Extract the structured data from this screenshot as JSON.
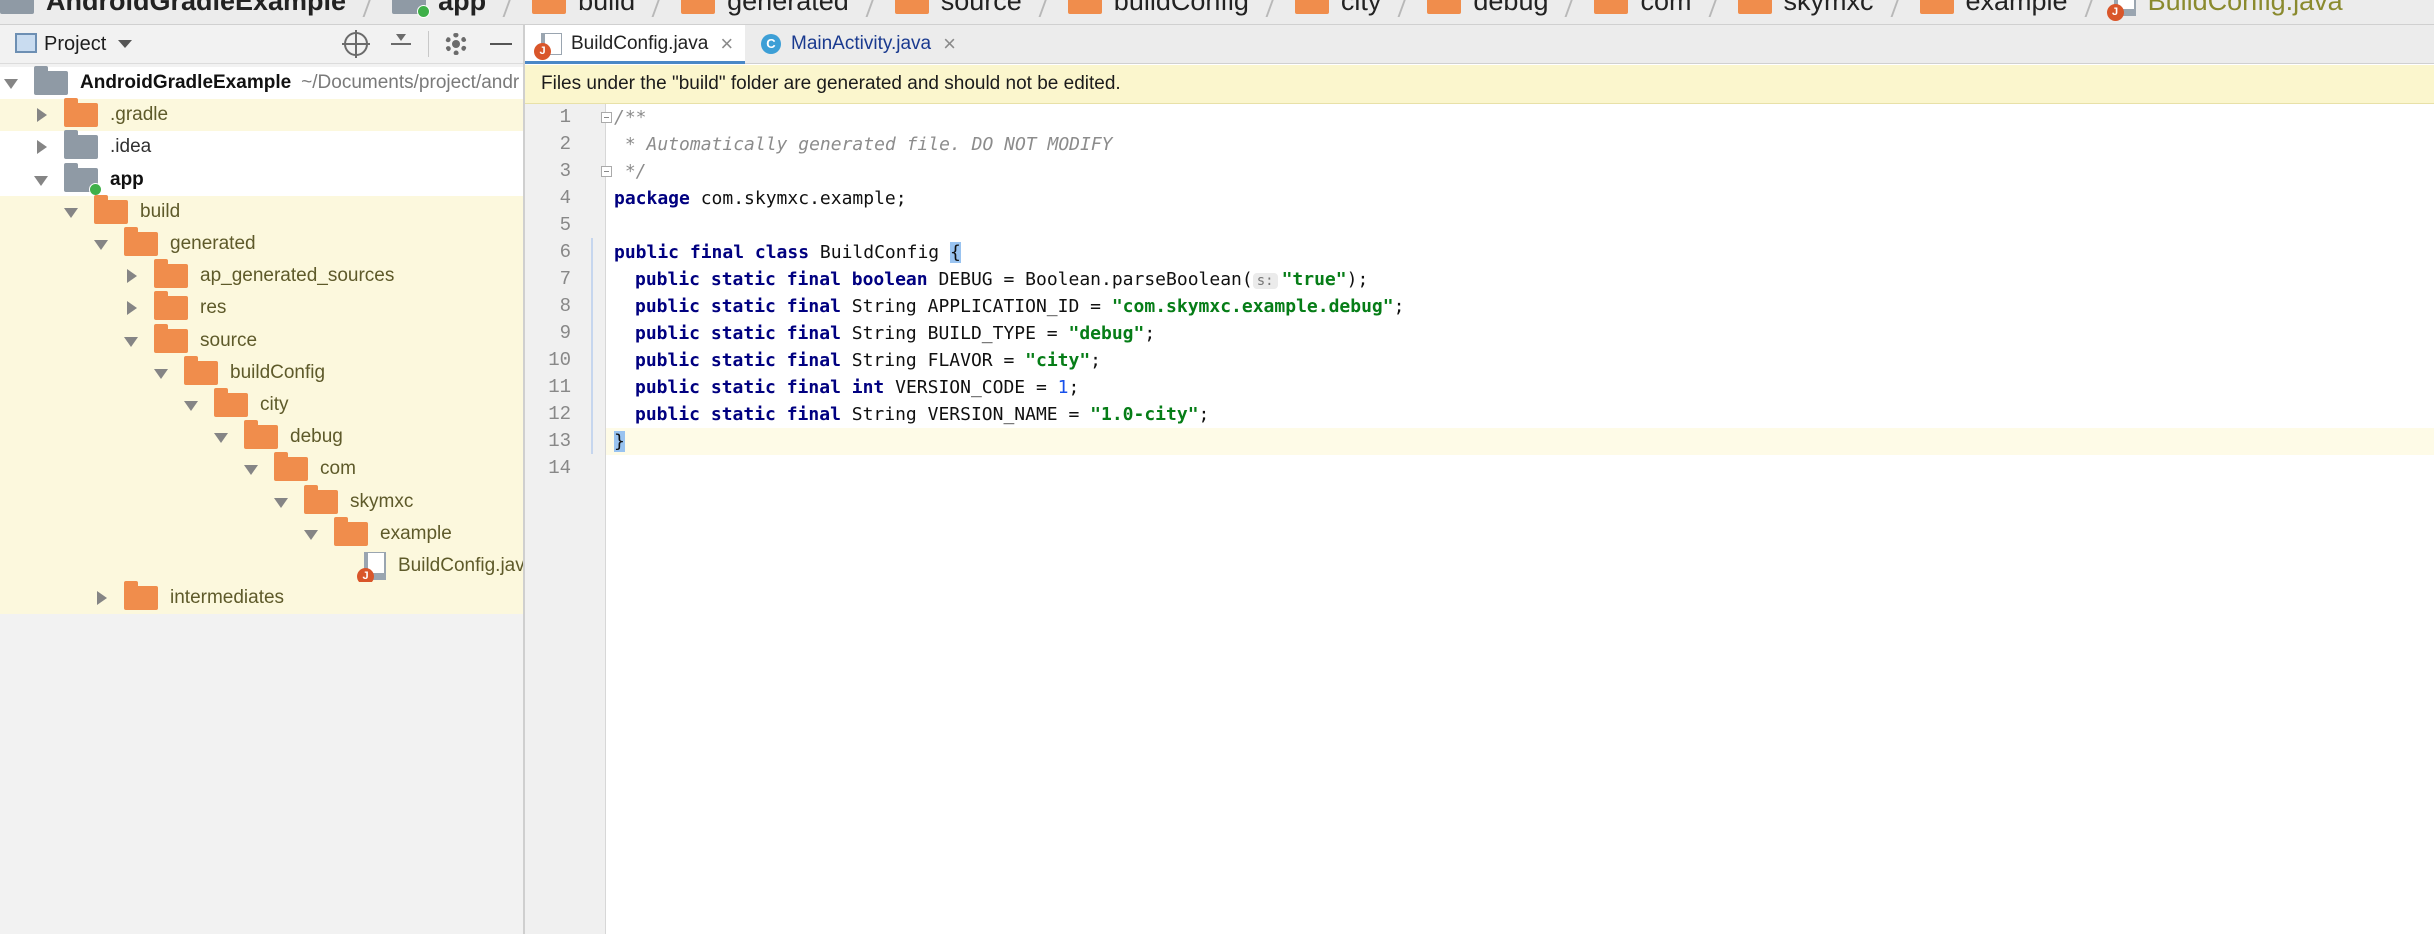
{
  "breadcrumb": {
    "items": [
      {
        "label": "AndroidGradleExample",
        "icon": "project-folder-icon"
      },
      {
        "label": "app",
        "icon": "module-folder-icon"
      },
      {
        "label": "build",
        "icon": "folder-icon"
      },
      {
        "label": "generated",
        "icon": "folder-icon"
      },
      {
        "label": "source",
        "icon": "folder-icon"
      },
      {
        "label": "buildConfig",
        "icon": "folder-icon"
      },
      {
        "label": "city",
        "icon": "folder-icon"
      },
      {
        "label": "debug",
        "icon": "folder-icon"
      },
      {
        "label": "com",
        "icon": "folder-icon"
      },
      {
        "label": "skymxc",
        "icon": "folder-icon"
      },
      {
        "label": "example",
        "icon": "folder-icon"
      },
      {
        "label": "BuildConfig.java",
        "icon": "java-file-icon"
      }
    ]
  },
  "project_panel": {
    "title": "Project",
    "tree": [
      {
        "label": "AndroidGradleExample",
        "path": "~/Documents/project/andr",
        "icon": "project-folder-icon"
      },
      {
        "label": ".gradle",
        "icon": "folder-icon"
      },
      {
        "label": ".idea",
        "icon": "folder-icon"
      },
      {
        "label": "app",
        "icon": "module-folder-icon"
      },
      {
        "label": "build",
        "icon": "folder-icon"
      },
      {
        "label": "generated",
        "icon": "folder-icon"
      },
      {
        "label": "ap_generated_sources",
        "icon": "folder-icon"
      },
      {
        "label": "res",
        "icon": "folder-icon"
      },
      {
        "label": "source",
        "icon": "folder-icon"
      },
      {
        "label": "buildConfig",
        "icon": "folder-icon"
      },
      {
        "label": "city",
        "icon": "folder-icon"
      },
      {
        "label": "debug",
        "icon": "folder-icon"
      },
      {
        "label": "com",
        "icon": "folder-icon"
      },
      {
        "label": "skymxc",
        "icon": "folder-icon"
      },
      {
        "label": "example",
        "icon": "folder-icon"
      },
      {
        "label": "BuildConfig.jav",
        "icon": "java-file-icon"
      },
      {
        "label": "intermediates",
        "icon": "folder-icon"
      }
    ]
  },
  "editor": {
    "tabs": [
      {
        "label": "BuildConfig.java",
        "close": "×",
        "active": true,
        "icon": "java-file-icon"
      },
      {
        "label": "MainActivity.java",
        "close": "×",
        "active": false,
        "icon": "class-c-icon"
      }
    ],
    "banner": "Files under the \"build\" folder are generated and should not be edited.",
    "line_numbers": [
      "1",
      "2",
      "3",
      "4",
      "5",
      "6",
      "7",
      "8",
      "9",
      "10",
      "11",
      "12",
      "13",
      "14"
    ],
    "code": {
      "l1": "/**",
      "l2": " * Automatically generated file. DO NOT MODIFY",
      "l3": " */",
      "kw_package": "package",
      "l4_rest": " com.skymxc.example;",
      "kw_public_final_class": "public final class",
      "l6_name": " BuildConfig ",
      "brace_open": "{",
      "kw_psf": "public static final",
      "kw_boolean": "boolean",
      "l7_mid": " DEBUG = Boolean.parseBoolean(",
      "l7_hint": "s:",
      "l7_str": "\"true\"",
      "l7_end": ");",
      "l8_mid": " String APPLICATION_ID = ",
      "l8_str": "\"com.skymxc.example.debug\"",
      "l9_mid": " String BUILD_TYPE = ",
      "l9_str": "\"debug\"",
      "l10_mid": " String FLAVOR = ",
      "l10_str": "\"city\"",
      "kw_int": "int",
      "l11_mid": " VERSION_CODE = ",
      "l11_num": "1",
      "l12_mid": " String VERSION_NAME = ",
      "l12_str": "\"1.0-city\"",
      "semicolon": ";",
      "brace_close": "}"
    }
  },
  "colors": {
    "folder": "#f08d4c",
    "banner": "#fbf6cd",
    "keyword": "#000080",
    "string": "#067d17",
    "number": "#1750eb",
    "comment": "#8c8c8c"
  }
}
